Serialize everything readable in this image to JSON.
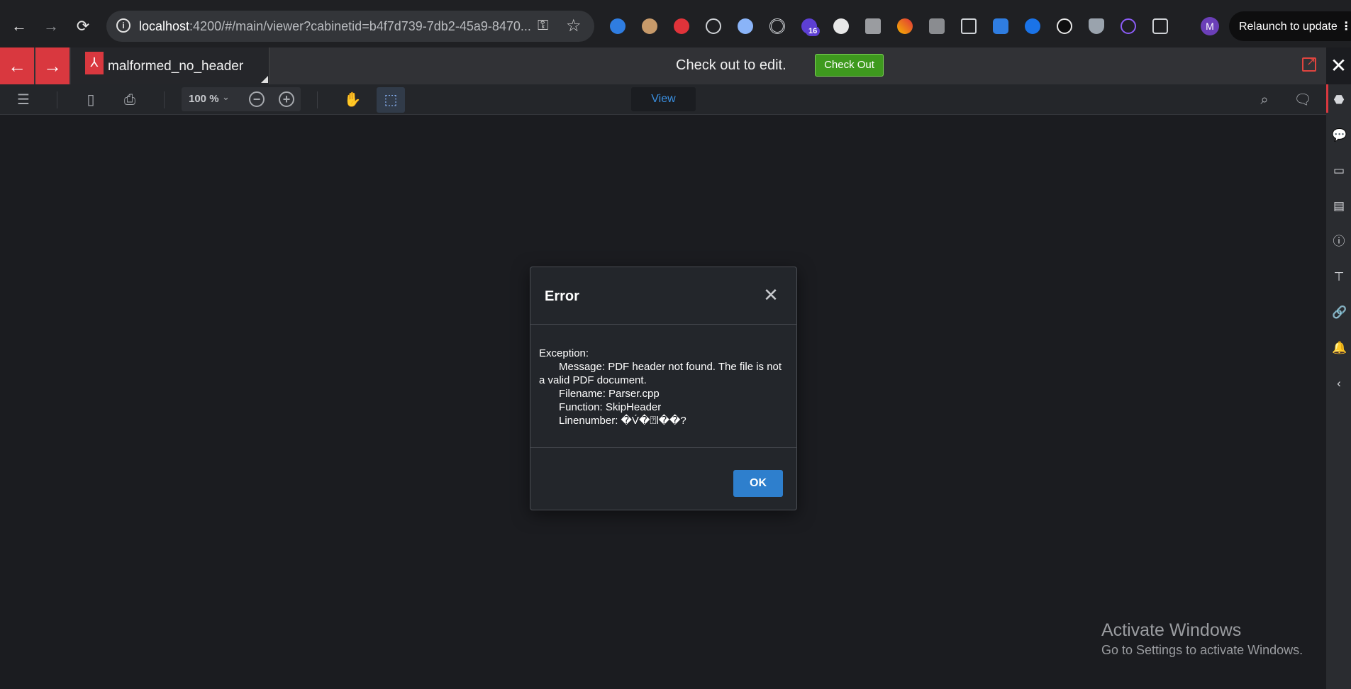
{
  "browser": {
    "url_host": "localhost",
    "url_rest": ":4200/#/main/viewer?cabinetid=b4f7d739-7db2-45a9-8470...",
    "extension_badge": "16",
    "profile_initial": "M",
    "relaunch_label": "Relaunch to update"
  },
  "tabbar": {
    "document_title": "malformed_no_header",
    "checkout_message": "Check out to edit.",
    "checkout_button": "Check Out"
  },
  "toolbar": {
    "zoom_level": "100 %",
    "view_tab": "View"
  },
  "dialog": {
    "title": "Error",
    "lines": {
      "exception": "Exception:",
      "message": "Message: PDF header not found. The file is not a valid PDF document.",
      "filename": "Filename: Parser.cpp",
      "function": "Function: SkipHeader",
      "linenumber": "Linenumber: �V́�⍰l��?"
    },
    "ok_label": "OK"
  },
  "watermark": {
    "line1": "Activate Windows",
    "line2": "Go to Settings to activate Windows."
  },
  "colors": {
    "accent_red": "#d9383f",
    "checkout_green": "#3e9a1e",
    "ok_blue": "#2e7fcd",
    "view_blue": "#3a8fe0"
  }
}
